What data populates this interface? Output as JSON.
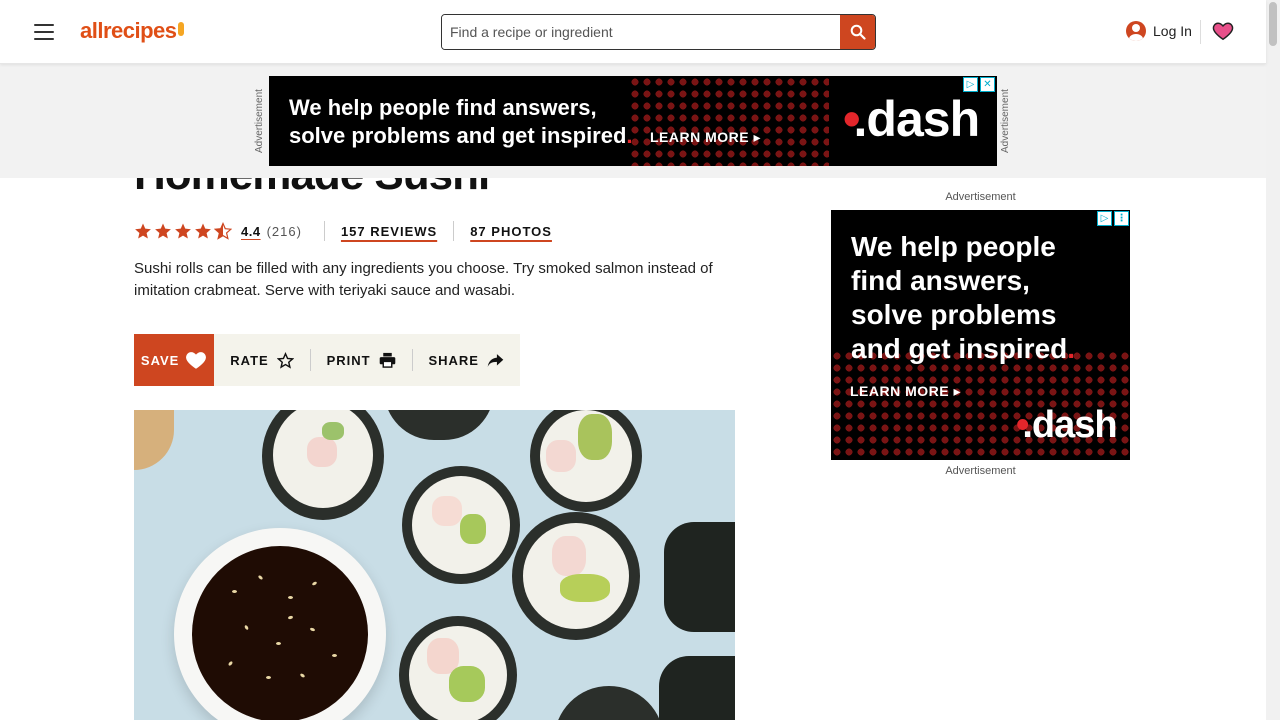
{
  "header": {
    "logo": "allrecipes",
    "search_placeholder": "Find a recipe or ingredient",
    "login_label": "Log In"
  },
  "top_ad": {
    "label": "Advertisement",
    "headline_line1": "We help people find answers,",
    "headline_line2": "solve problems and get inspired",
    "cta": "LEARN MORE",
    "brand": ".dash"
  },
  "recipe": {
    "title": "Homemade Sushi",
    "rating": "4.4",
    "rating_count": "(216)",
    "reviews_label": "157 REVIEWS",
    "photos_label": "87 PHOTOS",
    "description": "Sushi rolls can be filled with any ingredients you choose. Try smoked salmon instead of imitation crabmeat. Serve with teriyaki sauce and wasabi.",
    "actions": {
      "save": "SAVE",
      "rate": "RATE",
      "print": "PRINT",
      "share": "SHARE"
    }
  },
  "sidebar_ad": {
    "label_top": "Advertisement",
    "label_bottom": "Advertisement",
    "line1": "We help people",
    "line2": "find answers,",
    "line3": "solve problems",
    "line4": "and get inspired",
    "cta": "LEARN MORE",
    "brand": ".dash"
  },
  "colors": {
    "brand_orange": "#ce4620",
    "action_bar_bg": "#f4f3eb",
    "ad_black": "#000000",
    "heart_pink": "#e8508a"
  },
  "icons": [
    "menu-icon",
    "search-icon",
    "account-icon",
    "heart-icon",
    "star-icon",
    "print-icon",
    "share-icon",
    "adchoices-icon",
    "close-icon"
  ]
}
